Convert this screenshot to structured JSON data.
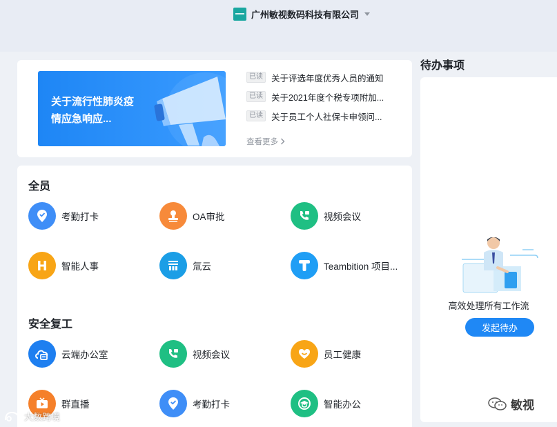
{
  "header": {
    "org_name": "广州敏视数码科技有限公司"
  },
  "notices": {
    "banner_text": "关于流行性肺炎疫情应急响应...",
    "items": [
      {
        "tag": "已读",
        "title": "关于评选年度优秀人员的通知"
      },
      {
        "tag": "已读",
        "title": "关于2021年度个税专项附加..."
      },
      {
        "tag": "已读",
        "title": "关于员工个人社保卡申领问..."
      }
    ],
    "more_label": "查看更多"
  },
  "apps": {
    "sections": [
      {
        "title": "全员",
        "items": [
          {
            "label": "考勤打卡",
            "icon": "location-check-icon",
            "color": "#3f8ef7"
          },
          {
            "label": "OA审批",
            "icon": "stamp-icon",
            "color": "#f78a3a"
          },
          {
            "label": "视频会议",
            "icon": "video-call-icon",
            "color": "#1fbf83"
          },
          {
            "label": "智能人事",
            "icon": "hr-icon",
            "color": "#f8a516"
          },
          {
            "label": "氚云",
            "icon": "cloud-form-icon",
            "color": "#1b9ee6"
          },
          {
            "label": "Teambition 项目...",
            "icon": "teambition-icon",
            "color": "#1f9ef5"
          }
        ]
      },
      {
        "title": "安全复工",
        "items": [
          {
            "label": "云端办公室",
            "icon": "cloud-office-icon",
            "color": "#1e7ff0"
          },
          {
            "label": "视频会议",
            "icon": "video-call-icon",
            "color": "#1fbf83"
          },
          {
            "label": "员工健康",
            "icon": "heart-icon",
            "color": "#f8a516"
          },
          {
            "label": "群直播",
            "icon": "live-tv-icon",
            "color": "#f5802a"
          },
          {
            "label": "考勤打卡",
            "icon": "location-check-icon",
            "color": "#3f8ef7"
          },
          {
            "label": "智能办公",
            "icon": "graduation-cap-icon",
            "color": "#1fbf83"
          }
        ]
      }
    ]
  },
  "todo": {
    "title": "待办事项",
    "empty_text": "高效处理所有工作流",
    "button_label": "发起待办"
  },
  "watermarks": {
    "right": "敏视",
    "left": "大数跨境"
  }
}
